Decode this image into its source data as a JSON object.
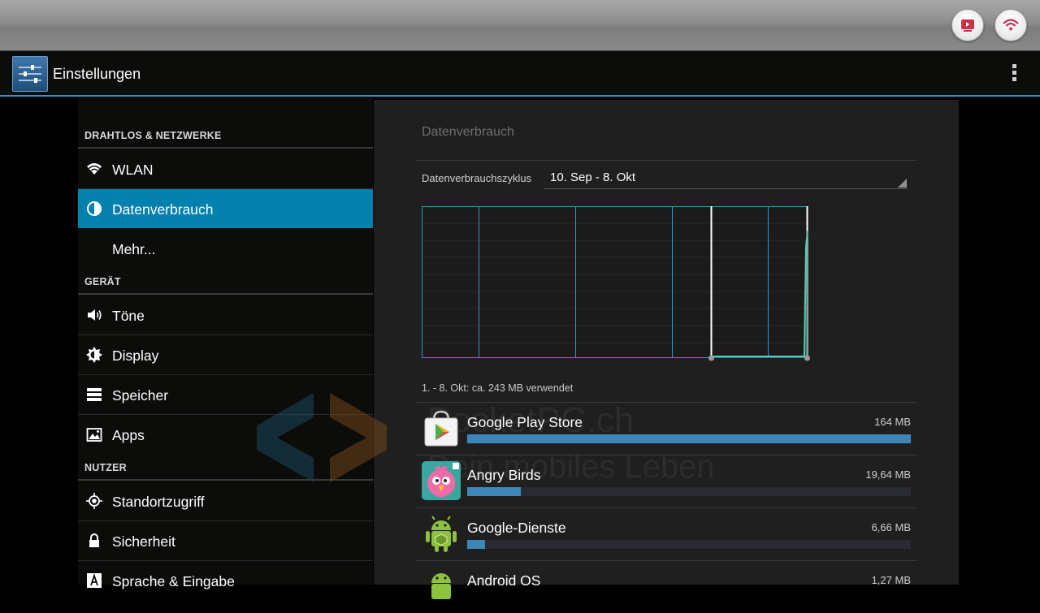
{
  "header": {
    "title": "Einstellungen"
  },
  "sidebar": {
    "sections": [
      {
        "title": "DRAHTLOS & NETZWERKE"
      },
      {
        "title": "GERÄT"
      },
      {
        "title": "NUTZER"
      }
    ],
    "items": [
      {
        "label": "WLAN",
        "icon": "wifi-icon"
      },
      {
        "label": "Datenverbrauch",
        "icon": "data-usage-icon",
        "selected": true
      },
      {
        "label": "Mehr..."
      },
      {
        "label": "Töne",
        "icon": "speaker-icon"
      },
      {
        "label": "Display",
        "icon": "brightness-icon"
      },
      {
        "label": "Speicher",
        "icon": "storage-icon"
      },
      {
        "label": "Apps",
        "icon": "apps-icon"
      },
      {
        "label": "Standortzugriff",
        "icon": "location-icon"
      },
      {
        "label": "Sicherheit",
        "icon": "lock-icon"
      },
      {
        "label": "Sprache & Eingabe",
        "icon": "language-icon"
      }
    ]
  },
  "panel": {
    "title": "Datenverbrauch",
    "cycle_label": "Datenverbrauchszyklus",
    "cycle_value": "10. Sep - 8. Okt",
    "summary": "1. - 8. Okt: ca. 243 MB verwendet",
    "apps": [
      {
        "name": "Google Play Store",
        "size": "164 MB",
        "icon": "play-store-icon",
        "fraction": 1.0
      },
      {
        "name": "Angry Birds",
        "size": "19,64 MB",
        "icon": "angry-birds-icon",
        "fraction": 0.12
      },
      {
        "name": "Google-Dienste",
        "size": "6,66 MB",
        "icon": "android-icon",
        "fraction": 0.04
      },
      {
        "name": "Android OS",
        "size": "1,27 MB",
        "icon": "android-icon",
        "fraction": 0.01
      }
    ]
  },
  "watermark": {
    "line1": "PocketPC.ch",
    "line2": "Dein mobiles Leben"
  },
  "colors": {
    "accent": "#0480ae",
    "chart_grid": "#2f97c6",
    "usage_line": "#4fd1b7",
    "bar": "#3e86b8"
  }
}
